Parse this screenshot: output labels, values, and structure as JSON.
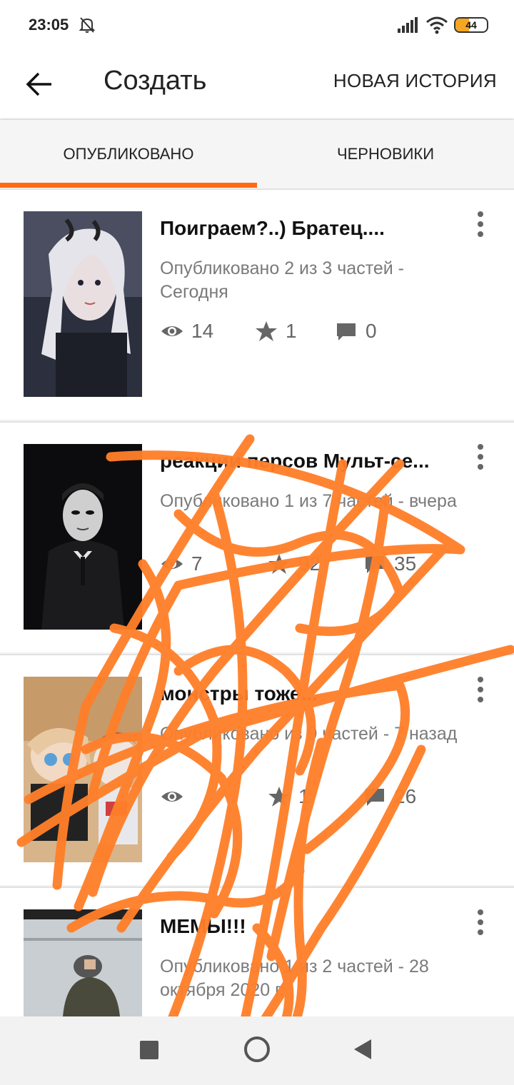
{
  "status_bar": {
    "time": "23:05",
    "battery": "44",
    "icons": [
      "bell-off-icon",
      "signal-icon",
      "wifi-icon",
      "battery-icon"
    ]
  },
  "header": {
    "title": "Создать",
    "new_story": "НОВАЯ ИСТОРИЯ",
    "back_icon": "arrow-back-icon"
  },
  "tabs": [
    {
      "label": "ОПУБЛИКОВАНО",
      "active": true
    },
    {
      "label": "ЧЕРНОВИКИ",
      "active": false
    }
  ],
  "stories": [
    {
      "title": "Поиграем?..) Братец....",
      "status": "Опубликовано 2 из 3 частей - Сегодня",
      "views": "14",
      "votes": "1",
      "comments": "0"
    },
    {
      "title": "реакции персов Мульт-се...",
      "status": "Опубликовано 1 из 7 частей - вчера",
      "views": "7",
      "votes": "92",
      "comments": "35"
    },
    {
      "title": "монстры тоже...",
      "status": "Опубликовано из 9 частей - 7 назад",
      "views": "",
      "votes": "1",
      "comments": "26"
    },
    {
      "title": "МЕМЫ!!!",
      "status": "Опубликовано 1 из 2 частей - 28 октября 2020 г.",
      "views": "",
      "votes": "",
      "comments": ""
    }
  ],
  "colors": {
    "accent": "#ff6a13",
    "scribble": "#ff7f2a",
    "meta_text": "#7a7a7a"
  },
  "nav": {
    "icons": [
      "recent-apps-icon",
      "home-icon",
      "back-triangle-icon"
    ]
  }
}
